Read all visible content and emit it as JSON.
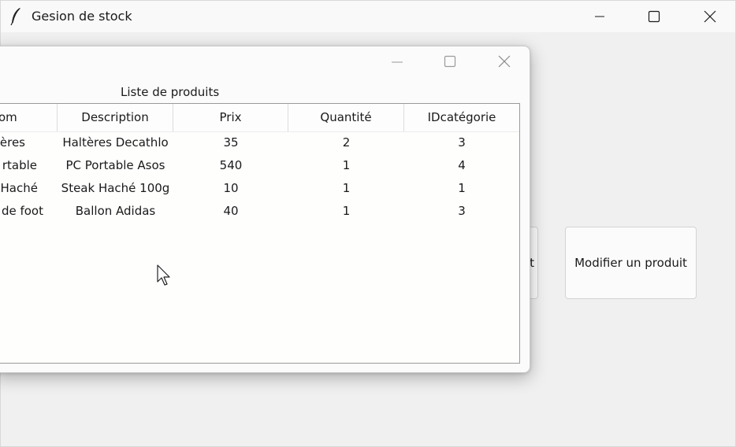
{
  "main_window": {
    "title": "Gesion de stock",
    "title_icon": "feather-icon",
    "controls": [
      "minimize-icon",
      "maximize-icon",
      "close-icon"
    ],
    "partial_button_label": "t",
    "modify_button_label": "Modifier un produit"
  },
  "child_window": {
    "controls": [
      "minimize-icon",
      "maximize-icon",
      "close-icon"
    ],
    "list_label": "Liste de produits",
    "columns": [
      "om",
      "Description",
      "Prix",
      "Quantité",
      "IDcatégorie"
    ],
    "rows": [
      {
        "nom": "ères",
        "description": "Haltères Decathlo",
        "prix": "35",
        "quantite": "2",
        "idcategorie": "3"
      },
      {
        "nom": "rtable",
        "description": "PC Portable Asos",
        "prix": "540",
        "quantite": "1",
        "idcategorie": "4"
      },
      {
        "nom": "Haché",
        "description": "Steak Haché 100g",
        "prix": "10",
        "quantite": "1",
        "idcategorie": "1"
      },
      {
        "nom": "de foot",
        "description": "Ballon Adidas",
        "prix": "40",
        "quantite": "1",
        "idcategorie": "3"
      }
    ]
  },
  "colors": {
    "window_bg": "#f0f0f0",
    "titlebar_bg": "#f9f9f9",
    "tree_border": "#9a9a9a"
  }
}
